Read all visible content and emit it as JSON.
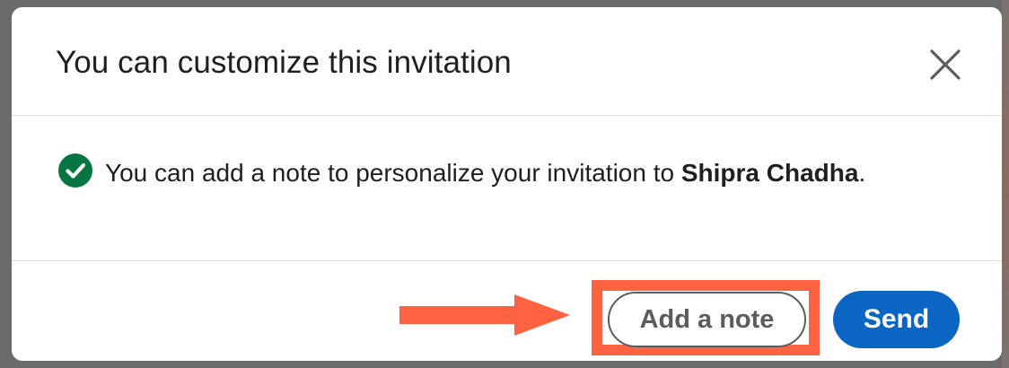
{
  "modal": {
    "title": "You can customize this invitation",
    "close_icon": "close-icon",
    "body": {
      "status_icon": "check-circle-icon",
      "message_prefix": "You can add a note to personalize your invitation to ",
      "recipient_name": "Shipra Chadha",
      "message_suffix": "."
    },
    "footer": {
      "add_note_label": "Add a note",
      "send_label": "Send"
    }
  },
  "annotation": {
    "arrow_icon": "right-arrow-icon",
    "highlight_color": "#ff6240"
  },
  "colors": {
    "accent": "#0a66c2",
    "success": "#057642",
    "text": "#1f1f1f",
    "secondary_button": "#5c5c5c"
  }
}
